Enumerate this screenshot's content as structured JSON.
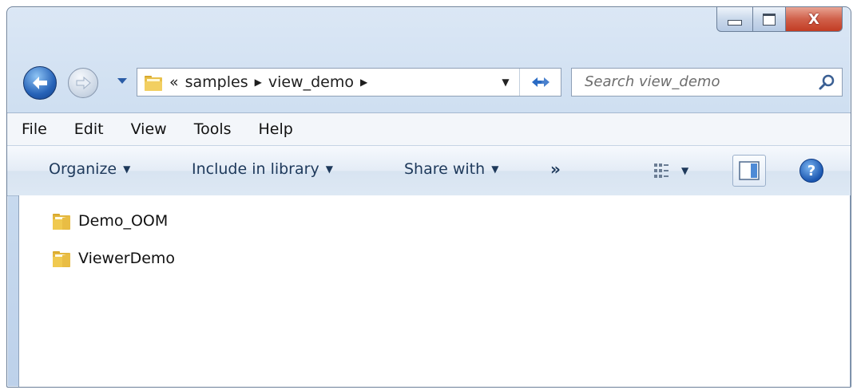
{
  "window": {
    "caption_buttons": {
      "minimize": "minimize",
      "maximize": "maximize",
      "close": "X"
    }
  },
  "nav": {
    "address_breadcrumbs": [
      "«",
      "samples",
      "view_demo"
    ],
    "search_placeholder": "Search view_demo",
    "back_icon": "back-arrow-icon",
    "forward_icon": "forward-arrow-icon",
    "refresh_icon": "refresh-icon"
  },
  "menu": {
    "items": [
      "File",
      "Edit",
      "View",
      "Tools",
      "Help"
    ]
  },
  "toolbar": {
    "organize": "Organize",
    "include_in_library": "Include in library",
    "share_with": "Share with",
    "more": "»"
  },
  "files": [
    {
      "name": "Demo_OOM",
      "type": "folder"
    },
    {
      "name": "ViewerDemo",
      "type": "folder"
    }
  ],
  "colors": {
    "chrome": "#c9dbef",
    "accent": "#1e395b",
    "close": "#c23c23"
  }
}
